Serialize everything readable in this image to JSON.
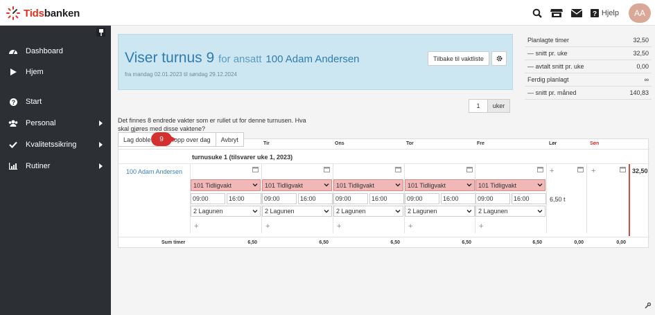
{
  "brand": {
    "name_a": "Tids",
    "name_b": "banken"
  },
  "topbar": {
    "help_label": "Hjelp",
    "avatar_initials": "AA"
  },
  "sidebar": {
    "items": [
      {
        "label": "Dashboard",
        "icon": "dashboard-icon"
      },
      {
        "label": "Hjem",
        "icon": "play-icon"
      },
      {
        "label": "Start",
        "icon": "question-icon"
      },
      {
        "label": "Personal",
        "icon": "users-icon"
      },
      {
        "label": "Kvalitetssikring",
        "icon": "check-icon"
      },
      {
        "label": "Rutiner",
        "icon": "chart-icon"
      }
    ]
  },
  "hero": {
    "title": "Viser turnus 9",
    "for_label": "for ansatt",
    "employee": "100 Adam Andersen",
    "subtitle": "fra mandag 02.01.2023 til søndag 29.12.2024",
    "back_button": "Tilbake til vaktliste"
  },
  "stats": [
    {
      "label": "Planlagte timer",
      "value": "32,50"
    },
    {
      "label": "— snitt pr. uke",
      "value": "32,50"
    },
    {
      "label": "— avtalt snitt pr. uke",
      "value": "0,00"
    },
    {
      "label": "Ferdig planlagt",
      "value": "∞"
    },
    {
      "label": "— snitt pr. måned",
      "value": "140,83"
    }
  ],
  "week_input": {
    "value": "1",
    "unit": "uker"
  },
  "message": "Det finnes 8 endrede vakter som er rullet ut for denne turnusen. Hva skal gjøres med disse vaktene?",
  "actions": {
    "double": "Lag doble v",
    "skip": "Hopp over dag",
    "cancel": "Avbryt",
    "badge": "9"
  },
  "schedule": {
    "days": [
      "Tir",
      "Ons",
      "Tor",
      "Fre",
      "Lør",
      "Søn"
    ],
    "week_title": "turnusuke 1 (tilsvarer uke 1, 2023)",
    "employee": "100 Adam Andersen",
    "shift": "101 Tidligvakt",
    "start": "09:00",
    "end": "16:00",
    "location": "2 Lagunen",
    "sat_hours": "6,50 t",
    "total": "32,50",
    "sum_label": "Sum timer",
    "sums": [
      "6,50",
      "6,50",
      "6,50",
      "6,50",
      "6,50",
      "0,00",
      "0,00"
    ]
  },
  "colors": {
    "accent": "#2f7bb0",
    "shift_bg": "#f2b8b8",
    "badge": "#d4302f",
    "sunday": "#d4302f"
  }
}
